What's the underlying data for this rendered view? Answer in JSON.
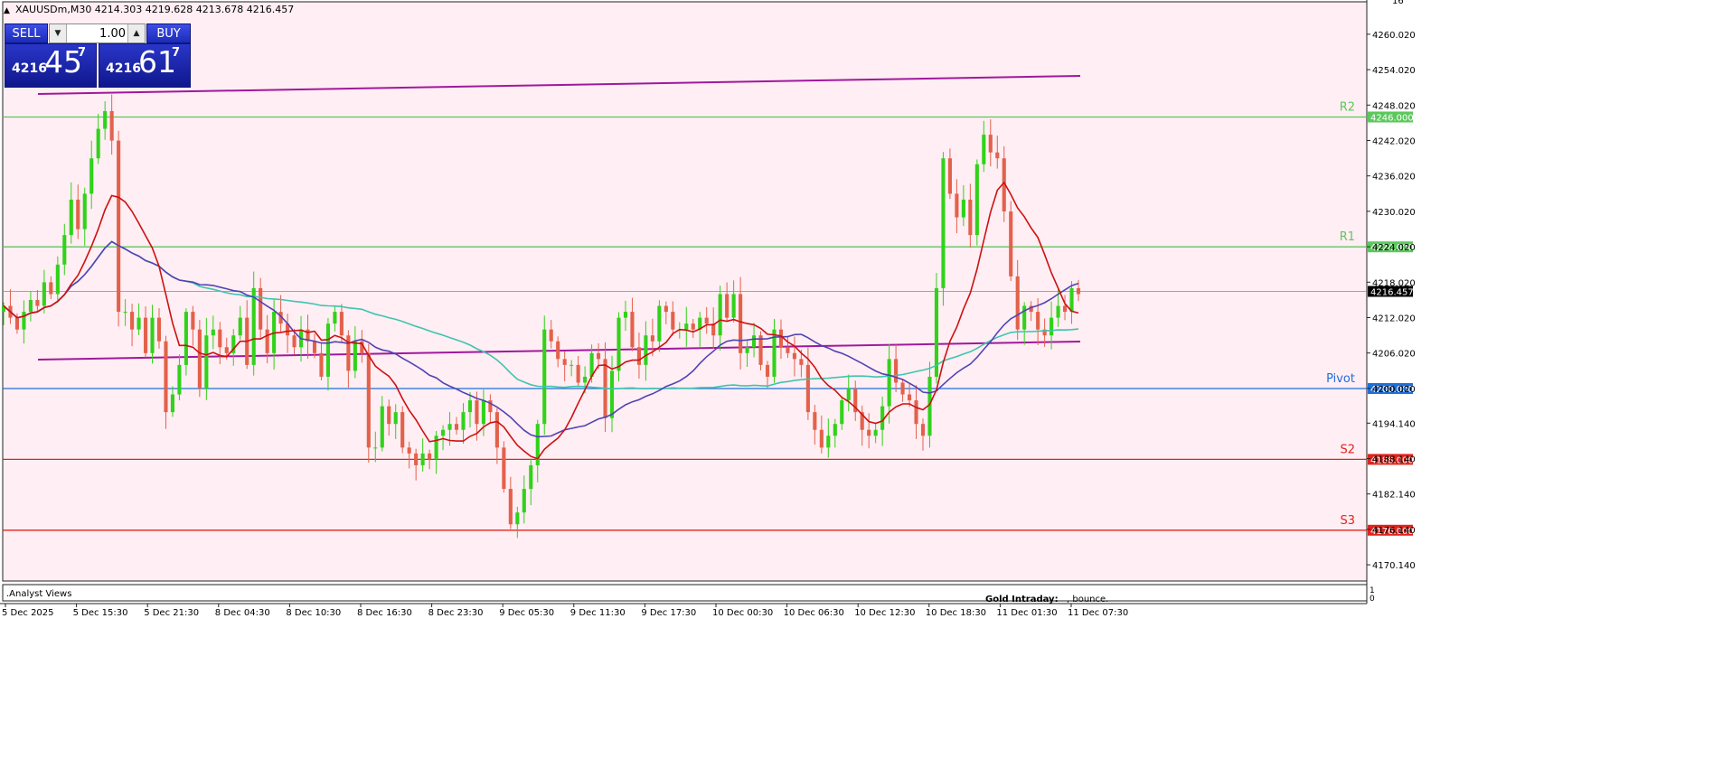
{
  "header": {
    "symbol_line": "XAUUSDm,M30  4214.303 4219.628 4213.678 4216.457",
    "menu_icon": "triangle-up-icon"
  },
  "trade_panel": {
    "sell_label": "SELL",
    "buy_label": "BUY",
    "lot_value": "1.00",
    "sell_price_prefix": "4216",
    "sell_price_big": "45",
    "sell_price_sup": "7",
    "buy_price_prefix": "4216",
    "buy_price_big": "61",
    "buy_price_sup": "7"
  },
  "indicator_panel": {
    "label": ".Analyst Views",
    "scale_top": "1",
    "scale_bottom": "0",
    "footer_label": "Gold Intraday:",
    "footer_text": ", bounce."
  },
  "price_axis": {
    "labels": [
      "4260.020",
      "4254.020",
      "4248.020",
      "4242.020",
      "4236.020",
      "4230.020",
      "4224.020",
      "4218.020",
      "4212.020",
      "4206.020",
      "4200.020",
      "4194.140",
      "4188.140",
      "4182.140",
      "4176.140",
      "4170.140"
    ],
    "top_partial_label": "16"
  },
  "time_axis": {
    "labels": [
      "5 Dec 2025",
      "5 Dec 15:30",
      "5 Dec 21:30",
      "8 Dec 04:30",
      "8 Dec 10:30",
      "8 Dec 16:30",
      "8 Dec 23:30",
      "9 Dec 05:30",
      "9 Dec 11:30",
      "9 Dec 17:30",
      "10 Dec 00:30",
      "10 Dec 06:30",
      "10 Dec 12:30",
      "10 Dec 18:30",
      "11 Dec 01:30",
      "11 Dec 07:30"
    ]
  },
  "chart_data": {
    "type": "candlestick",
    "symbol": "XAUUSDm",
    "timeframe": "M30",
    "ohlc_current": {
      "open": 4214.303,
      "high": 4219.628,
      "low": 4213.678,
      "close": 4216.457
    },
    "ylim": [
      4166.5,
      4266.5
    ],
    "levels": [
      {
        "name": "R2",
        "value": 4246.0,
        "label": "4246.000",
        "color": "#5cc85c"
      },
      {
        "name": "R1",
        "value": 4224.0,
        "label": "4224.000",
        "color": "#5cc85c"
      },
      {
        "name": "Pivot",
        "value": 4200.0,
        "label": "4200.000",
        "color": "#1e6fd9"
      },
      {
        "name": "S2",
        "value": 4188.0,
        "label": "4188.000",
        "color": "#e0241c"
      },
      {
        "name": "S3",
        "value": 4176.0,
        "label": "4176.000",
        "color": "#e0241c"
      }
    ],
    "current_price": {
      "value": 4216.457,
      "label": "4216.457"
    },
    "candles_close": [
      4214,
      4212,
      4210,
      4213,
      4215,
      4214,
      4218,
      4216,
      4221,
      4226,
      4232,
      4227,
      4233,
      4239,
      4244,
      4247,
      4242,
      4213,
      4213,
      4210,
      4212,
      4206,
      4212,
      4208,
      4196,
      4199,
      4204,
      4213,
      4210,
      4200,
      4209,
      4210,
      4207,
      4206,
      4209,
      4212,
      4204,
      4217,
      4210,
      4206,
      4213,
      4211,
      4209,
      4207,
      4210,
      4208,
      4206,
      4202,
      4211,
      4213,
      4209,
      4203,
      4208,
      4206,
      4190,
      4190,
      4197,
      4194,
      4196,
      4190,
      4189,
      4187,
      4189,
      4188,
      4192,
      4193,
      4194,
      4193,
      4196,
      4198,
      4194,
      4198,
      4196,
      4190,
      4183,
      4177,
      4179,
      4183,
      4187,
      4194,
      4210,
      4208,
      4205,
      4204,
      4204,
      4201,
      4202,
      4206,
      4205,
      4195,
      4203,
      4212,
      4213,
      4207,
      4204,
      4209,
      4208,
      4214,
      4213,
      4210,
      4210,
      4211,
      4210,
      4212,
      4211,
      4209,
      4216,
      4212,
      4216,
      4206,
      4207,
      4209,
      4204,
      4202,
      4210,
      4207,
      4206,
      4205,
      4204,
      4196,
      4193,
      4190,
      4192,
      4194,
      4198,
      4200,
      4196,
      4193,
      4192,
      4193,
      4197,
      4205,
      4201,
      4199,
      4198,
      4194,
      4192,
      4202,
      4217,
      4239,
      4233,
      4229,
      4232,
      4226,
      4238,
      4243,
      4240,
      4239,
      4230,
      4219,
      4210,
      4214,
      4213,
      4210,
      4209,
      4212,
      4214,
      4213,
      4217,
      4216
    ]
  },
  "colors": {
    "background": "#ffeef3",
    "bull": "#31d21a",
    "bear": "#e3614b",
    "ma_fast": "#cc1111",
    "ma_mid": "#5043b4",
    "ma_slow": "#3fc4ae",
    "trendline": "#a0189e",
    "resistance": "#5cc85c",
    "pivot": "#1e6fd9",
    "support": "#e0241c"
  }
}
